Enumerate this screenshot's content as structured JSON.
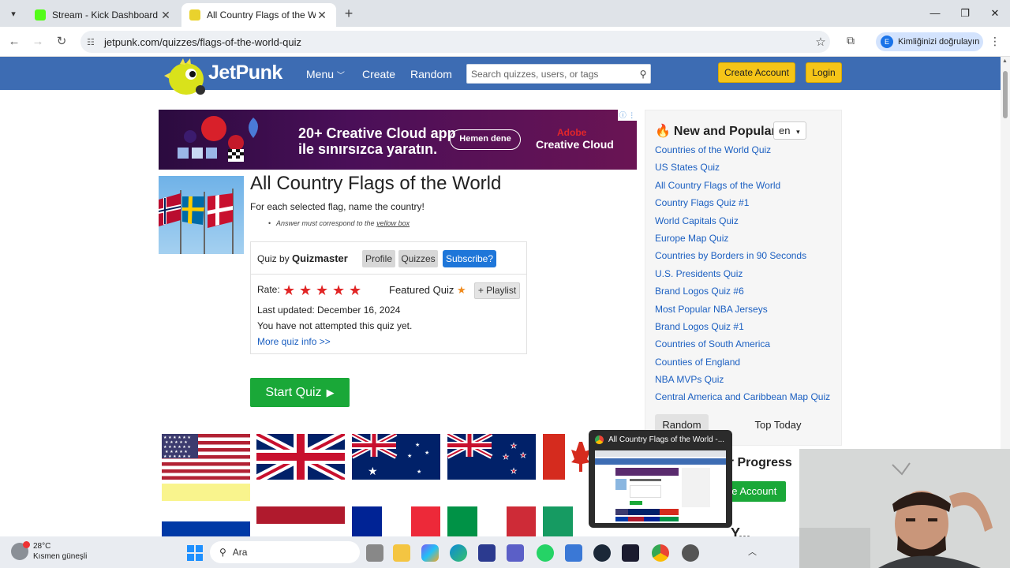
{
  "browser": {
    "tabs": [
      {
        "label": "Stream - Kick Dashboard",
        "favicon_color": "#53fc18"
      },
      {
        "label": "All Country Flags of the World",
        "favicon_color": "#e9d22d"
      }
    ],
    "url": "jetpunk.com/quizzes/flags-of-the-world-quiz",
    "profile_label": "Kimliğinizi doğrulayın",
    "profile_initial": "E"
  },
  "site": {
    "logo_text": "JetPunk",
    "nav": {
      "menu": "Menu",
      "create": "Create",
      "random": "Random"
    },
    "search_placeholder": "Search quizzes, users, or tags",
    "create_account": "Create Account",
    "login": "Login"
  },
  "ad": {
    "headline": "20+ Creative Cloud app ile sınırsızca yaratın.",
    "cta": "Hemen dene",
    "brand_top": "Adobe",
    "brand": "Creative Cloud"
  },
  "quiz": {
    "title": "All Country Flags of the World",
    "description": "For each selected flag, name the country!",
    "note_prefix": "Answer must correspond to the ",
    "note_link": "yellow box",
    "by_label": "Quiz by",
    "author": "Quizmaster",
    "profile_btn": "Profile",
    "quizzes_btn": "Quizzes",
    "subscribe_btn": "Subscribe?",
    "rate_label": "Rate:",
    "rating_stars": 5,
    "featured_label": "Featured Quiz",
    "playlist_btn": "+ Playlist",
    "last_updated": "Last updated: December 16, 2024",
    "attempt_status": "You have not attempted this quiz yet.",
    "more_info": "More quiz info >>",
    "start_btn": "Start Quiz"
  },
  "sidebar": {
    "title": "New and Popular",
    "language": "en",
    "links": [
      "Countries of the World Quiz",
      "US States Quiz",
      "All Country Flags of the World",
      "Country Flags Quiz #1",
      "World Capitals Quiz",
      "Europe Map Quiz",
      "Countries by Borders in 90 Seconds",
      "U.S. Presidents Quiz",
      "Brand Logos Quiz #6",
      "Most Popular NBA Jerseys",
      "Brand Logos Quiz #1",
      "Countries of South America",
      "Counties of England",
      "NBA MVPs Quiz",
      "Central America and Caribbean Map Quiz"
    ],
    "random_btn": "Random",
    "top_today_btn": "Top Today",
    "progress_title": "ur Progress",
    "create_account_green": "te Account",
    "partial_text": "Y..."
  },
  "thumbnail_popup": {
    "title": "All Country Flags of the World -..."
  },
  "taskbar": {
    "temperature": "28°C",
    "weather": "Kısmen güneşli",
    "search_label": "Ara"
  }
}
